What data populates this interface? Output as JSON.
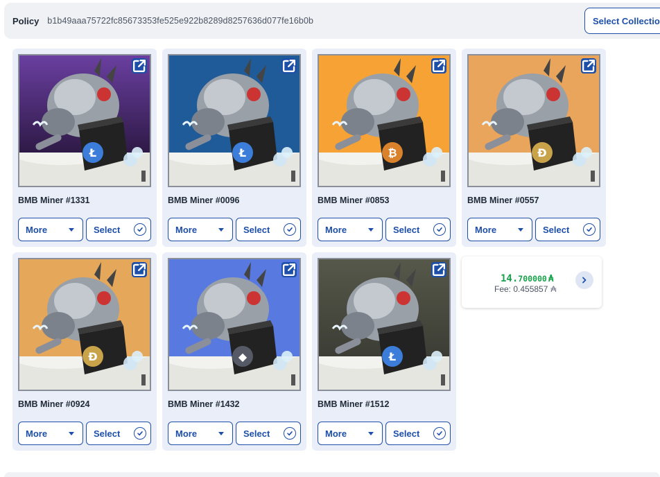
{
  "policy": {
    "label": "Policy",
    "id": "b1b49aaa75722fc85673353fe525e922b8289d8257636d077fe16b0b",
    "select_collection_label": "Select Collection"
  },
  "cards": [
    {
      "title": "BMB Miner #1331",
      "more_label": "More",
      "select_label": "Select",
      "bg": "#6a3fa0",
      "bg2": "#2a1740",
      "coin": "#3b7dd8",
      "coin_symbol": "Ł"
    },
    {
      "title": "BMB Miner #0096",
      "more_label": "More",
      "select_label": "Select",
      "bg": "#1f5a99",
      "bg2": "#1f5a99",
      "coin": "#3b7dd8",
      "coin_symbol": "Ł"
    },
    {
      "title": "BMB Miner #0853",
      "more_label": "More",
      "select_label": "Select",
      "bg": "#f7a234",
      "bg2": "#f7a234",
      "coin": "#d9822b",
      "coin_symbol": "₿"
    },
    {
      "title": "BMB Miner #0557",
      "more_label": "More",
      "select_label": "Select",
      "bg": "#e9a55b",
      "bg2": "#e9a55b",
      "coin": "#c9a34a",
      "coin_symbol": "Đ"
    },
    {
      "title": "BMB Miner #0924",
      "more_label": "More",
      "select_label": "Select",
      "bg": "#e5a75a",
      "bg2": "#e5a75a",
      "coin": "#c9a34a",
      "coin_symbol": "Đ"
    },
    {
      "title": "BMB Miner #1432",
      "more_label": "More",
      "select_label": "Select",
      "bg": "#5879e0",
      "bg2": "#5879e0",
      "coin": "#555a66",
      "coin_symbol": "◆"
    },
    {
      "title": "BMB Miner #1512",
      "more_label": "More",
      "select_label": "Select",
      "bg": "#56584a",
      "bg2": "#3a3b33",
      "coin": "#3b7dd8",
      "coin_symbol": "Ł"
    }
  ],
  "price": {
    "amount_int": "14.",
    "amount_dec": "700000",
    "currency_symbol": "₳",
    "fee_label": "Fee: 0.455857",
    "fee_symbol": "₳"
  },
  "colors": {
    "accent": "#1e4fa8",
    "card_bg": "#e9eef8",
    "price_green": "#16a34a"
  },
  "icons": [
    "external-link-icon",
    "chevron-down-icon",
    "check-circle-icon",
    "chevron-right-icon"
  ]
}
